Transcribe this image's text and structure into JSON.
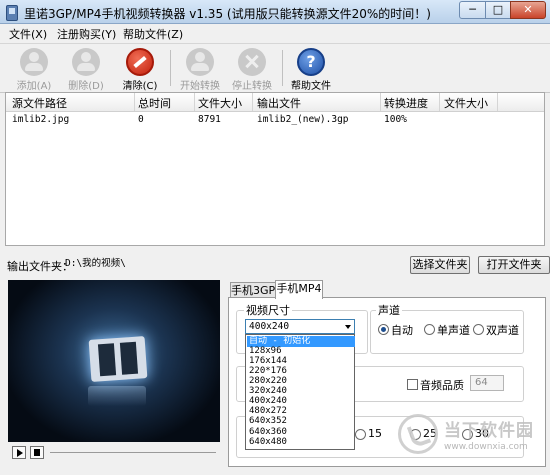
{
  "window": {
    "title": "里诺3GP/MP4手机视频转换器 v1.35 (试用版只能转换源文件20%的时间！)",
    "min_glyph": "─",
    "max_glyph": "□",
    "close_glyph": "✕"
  },
  "menu": [
    "文件(X)",
    "注册购买(Y)",
    "帮助文件(Z)"
  ],
  "toolbar": {
    "add": "添加(A)",
    "delete": "删除(D)",
    "clear": "清除(C)",
    "start": "开始转换",
    "stop": "停止转换",
    "help": "帮助文件",
    "help_glyph": "?"
  },
  "file_list": {
    "columns": [
      "源文件路径",
      "总时间",
      "文件大小",
      "输出文件",
      "转换进度",
      "文件大小"
    ],
    "rows": [
      [
        "imlib2.jpg",
        "0",
        "8791",
        "imlib2_(new).3gp",
        "100%",
        ""
      ]
    ]
  },
  "output": {
    "label": "输出文件夹：",
    "path": "D:\\我的视频\\",
    "choose_button": "选择文件夹",
    "open_button": "打开文件夹"
  },
  "tabs": [
    "手机3GP",
    "手机MP4"
  ],
  "active_tab": 1,
  "video_size": {
    "label": "视频尺寸",
    "selected": "400x240",
    "options": [
      "自动 - 初始化",
      "128x96",
      "176x144",
      "220*176",
      "280x220",
      "320x240",
      "400x240",
      "480x272",
      "640x352",
      "640x360",
      "640x480"
    ]
  },
  "channel": {
    "label": "声道",
    "options": [
      "自动",
      "单声道",
      "双声道"
    ],
    "selected": 0
  },
  "audio_quality": {
    "label": "音频品质",
    "value": "64"
  },
  "framerate": {
    "visible_options": [
      "15",
      "25",
      "30"
    ]
  },
  "watermark": {
    "name": "当下软件园",
    "url": "www.downxia.com"
  }
}
